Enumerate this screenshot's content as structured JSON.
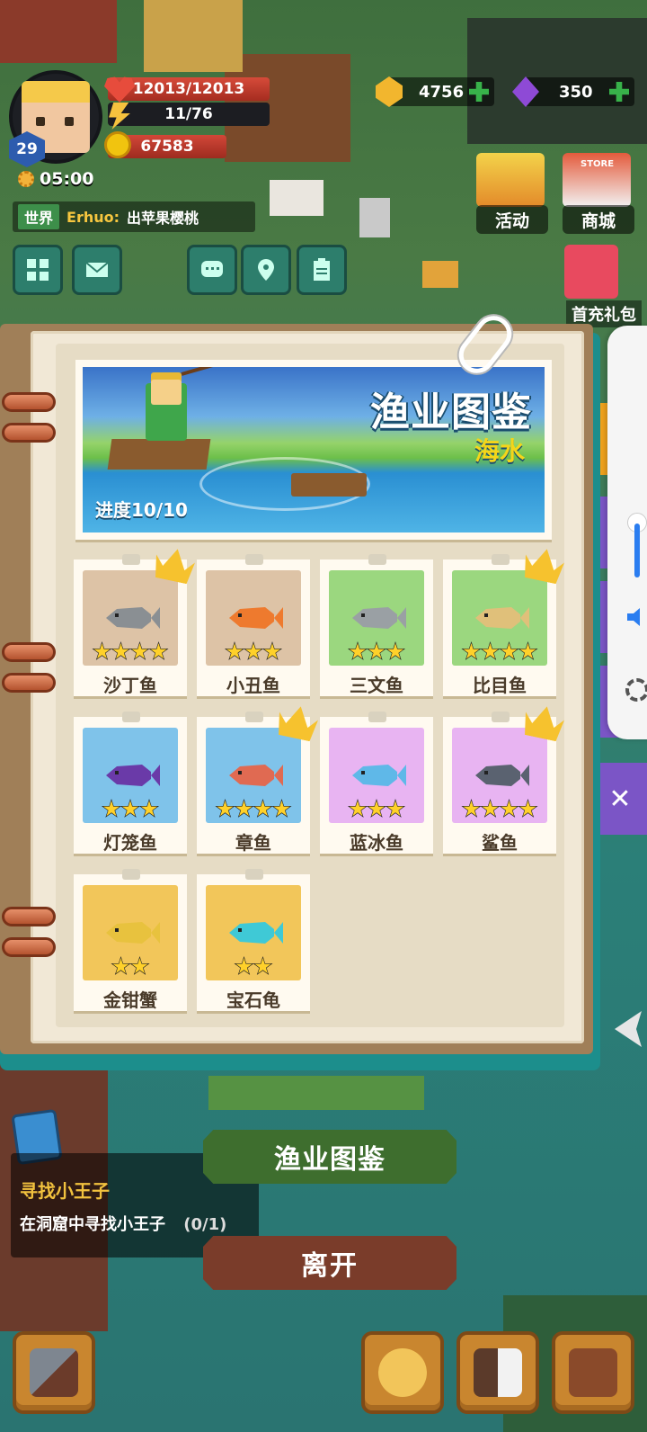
{
  "hud": {
    "level": "29",
    "timer": "05:00",
    "hp": "12013/12013",
    "xp": "11/76",
    "gold": "67583",
    "gems_yellow": "4756",
    "gems_purple": "350",
    "chat": {
      "channel": "世界",
      "name": "Erhuo:",
      "message": "出苹果樱桃"
    },
    "activity_label": "活动",
    "store_label": "商城",
    "store_sign": "STORE",
    "gift_label": "首充礼包"
  },
  "book": {
    "title": "渔业图鉴",
    "subtitle": "海水",
    "progress": "进度10/10",
    "fish": [
      {
        "name": "沙丁鱼",
        "stars": 4,
        "crown": true,
        "bg": "tan",
        "color": "#8a8f93"
      },
      {
        "name": "小丑鱼",
        "stars": 3,
        "crown": false,
        "bg": "tan",
        "color": "#ee7a2e"
      },
      {
        "name": "三文鱼",
        "stars": 3,
        "crown": false,
        "bg": "green",
        "color": "#9aa0a4"
      },
      {
        "name": "比目鱼",
        "stars": 4,
        "crown": true,
        "bg": "green",
        "color": "#e0c07a"
      },
      {
        "name": "灯笼鱼",
        "stars": 3,
        "crown": false,
        "bg": "blue",
        "color": "#6a3aa8"
      },
      {
        "name": "章鱼",
        "stars": 4,
        "crown": true,
        "bg": "blue",
        "color": "#e06a52"
      },
      {
        "name": "蓝冰鱼",
        "stars": 3,
        "crown": false,
        "bg": "pink",
        "color": "#5fb8e8"
      },
      {
        "name": "鲨鱼",
        "stars": 4,
        "crown": true,
        "bg": "pink",
        "color": "#5a6270"
      },
      {
        "name": "金钳蟹",
        "stars": 2,
        "crown": false,
        "bg": "gold",
        "color": "#e8c23e"
      },
      {
        "name": "宝石龟",
        "stars": 2,
        "crown": false,
        "bg": "gold",
        "color": "#3fc9d6"
      }
    ]
  },
  "buttons": {
    "encyclopedia": "渔业图鉴",
    "leave": "离开"
  },
  "quest": {
    "title": "寻找小王子",
    "description": "在洞窟中寻找小王子",
    "count": "(0/1)"
  }
}
